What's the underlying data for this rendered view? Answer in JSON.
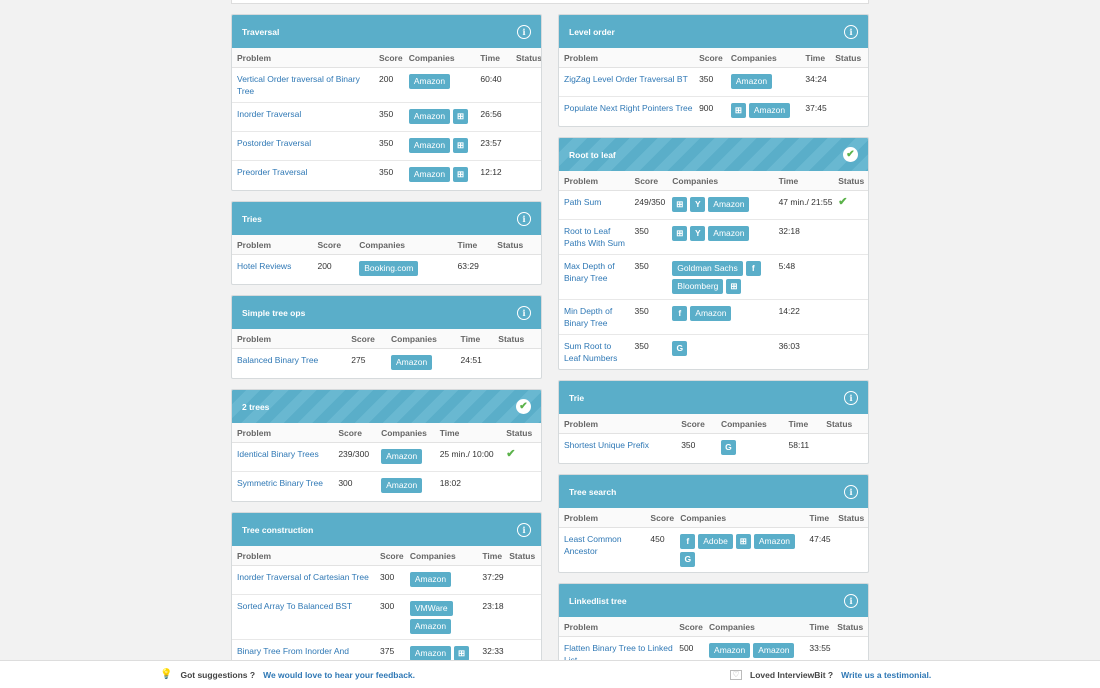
{
  "icons": {
    "info": "i",
    "check": "✔",
    "windows": "⊞",
    "facebook": "f",
    "google": "G",
    "yahoo": "Y"
  },
  "left": [
    {
      "title": "Traversal",
      "done": false,
      "cols": [
        "Problem",
        "Score",
        "Companies",
        "Time",
        "Status"
      ],
      "widths": [
        143,
        30,
        72,
        36,
        30
      ],
      "rows": [
        {
          "problem": "Vertical Order traversal of Binary Tree",
          "score": "200",
          "companies": [
            "Amazon"
          ],
          "time": "60:40",
          "status": ""
        },
        {
          "problem": "Inorder Traversal",
          "score": "350",
          "companies": [
            "Amazon",
            "windows"
          ],
          "time": "26:56",
          "status": ""
        },
        {
          "problem": "Postorder Traversal",
          "score": "350",
          "companies": [
            "Amazon",
            "windows"
          ],
          "time": "23:57",
          "status": ""
        },
        {
          "problem": "Preorder Traversal",
          "score": "350",
          "companies": [
            "Amazon",
            "windows"
          ],
          "time": "12:12",
          "status": ""
        }
      ]
    },
    {
      "title": "Tries",
      "done": false,
      "cols": [
        "Problem",
        "Score",
        "Companies",
        "Time",
        "Status"
      ],
      "widths": [
        81,
        42,
        99,
        40,
        49
      ],
      "rows": [
        {
          "problem": "Hotel Reviews",
          "score": "200",
          "companies": [
            "Booking.com"
          ],
          "time": "63:29",
          "status": ""
        }
      ]
    },
    {
      "title": "Simple tree ops",
      "done": false,
      "cols": [
        "Problem",
        "Score",
        "Companies",
        "Time",
        "Status"
      ],
      "widths": [
        115,
        40,
        70,
        38,
        48
      ],
      "rows": [
        {
          "problem": "Balanced Binary Tree",
          "score": "275",
          "companies": [
            "Amazon"
          ],
          "time": "24:51",
          "status": ""
        }
      ]
    },
    {
      "title": "2 trees",
      "done": true,
      "cols": [
        "Problem",
        "Score",
        "Companies",
        "Time",
        "Status"
      ],
      "widths": [
        102,
        43,
        59,
        67,
        40
      ],
      "rows": [
        {
          "problem": "Identical Binary Trees",
          "score": "239/300",
          "companies": [
            "Amazon"
          ],
          "time": "25 min./ 10:00",
          "status": "check"
        },
        {
          "problem": "Symmetric Binary Tree",
          "score": "300",
          "companies": [
            "Amazon"
          ],
          "time": "18:02",
          "status": ""
        }
      ]
    },
    {
      "title": "Tree construction",
      "done": false,
      "cols": [
        "Problem",
        "Score",
        "Companies",
        "Time",
        "Status"
      ],
      "widths": [
        144,
        30,
        73,
        27,
        37
      ],
      "rows": [
        {
          "problem": "Inorder Traversal of Cartesian Tree",
          "score": "300",
          "companies": [
            "Amazon"
          ],
          "time": "37:29",
          "status": ""
        },
        {
          "problem": "Sorted Array To Balanced BST",
          "score": "300",
          "companies": [
            "VMWare",
            "Amazon"
          ],
          "time": "23:18",
          "status": ""
        },
        {
          "problem": "Binary Tree From Inorder And Postorder",
          "score": "375",
          "companies": [
            "Amazon",
            "windows"
          ],
          "time": "32:33",
          "status": ""
        }
      ]
    }
  ],
  "right": [
    {
      "title": "Level order",
      "done": false,
      "cols": [
        "Problem",
        "Score",
        "Companies",
        "Time",
        "Status"
      ],
      "widths": [
        136,
        32,
        75,
        30,
        38
      ],
      "rows": [
        {
          "problem": "ZigZag Level Order Traversal BT",
          "score": "350",
          "companies": [
            "Amazon"
          ],
          "time": "34:24",
          "status": ""
        },
        {
          "problem": "Populate Next Right Pointers Tree",
          "score": "900",
          "companies": [
            "windows",
            "Amazon"
          ],
          "time": "37:45",
          "status": ""
        }
      ]
    },
    {
      "title": "Root to leaf",
      "done": true,
      "cols": [
        "Problem",
        "Score",
        "Companies",
        "Time",
        "Status"
      ],
      "widths": [
        71,
        38,
        107,
        60,
        35
      ],
      "rows": [
        {
          "problem": "Path Sum",
          "score": "249/350",
          "companies": [
            "windows",
            "yahoo",
            "Amazon"
          ],
          "time": "47 min./ 21:55",
          "status": "check"
        },
        {
          "problem": "Root to Leaf Paths With Sum",
          "score": "350",
          "companies": [
            "windows",
            "yahoo",
            "Amazon"
          ],
          "time": "32:18",
          "status": ""
        },
        {
          "problem": "Max Depth of Binary Tree",
          "score": "350",
          "companies": [
            "Goldman Sachs",
            "facebook",
            "Bloomberg",
            "windows"
          ],
          "time": "5:48",
          "status": ""
        },
        {
          "problem": "Min Depth of Binary Tree",
          "score": "350",
          "companies": [
            "facebook",
            "Amazon"
          ],
          "time": "14:22",
          "status": ""
        },
        {
          "problem": "Sum Root to Leaf Numbers",
          "score": "350",
          "companies": [
            "google"
          ],
          "time": "36:03",
          "status": ""
        }
      ]
    },
    {
      "title": "Trie",
      "done": false,
      "cols": [
        "Problem",
        "Score",
        "Companies",
        "Time",
        "Status"
      ],
      "widths": [
        118,
        40,
        68,
        38,
        47
      ],
      "rows": [
        {
          "problem": "Shortest Unique Prefix",
          "score": "350",
          "companies": [
            "google"
          ],
          "time": "58:11",
          "status": ""
        }
      ]
    },
    {
      "title": "Tree search",
      "done": false,
      "cols": [
        "Problem",
        "Score",
        "Companies",
        "Time",
        "Status"
      ],
      "widths": [
        87,
        30,
        130,
        29,
        35
      ],
      "rows": [
        {
          "problem": "Least Common Ancestor",
          "score": "450",
          "companies": [
            "facebook",
            "Adobe",
            "windows",
            "Amazon",
            "google"
          ],
          "time": "47:45",
          "status": ""
        }
      ]
    },
    {
      "title": "Linkedlist tree",
      "done": false,
      "cols": [
        "Problem",
        "Score",
        "Companies",
        "Time",
        "Status"
      ],
      "widths": [
        116,
        30,
        101,
        28,
        36
      ],
      "rows": [
        {
          "problem": "Flatten Binary Tree to Linked List",
          "score": "500",
          "companies": [
            "Amazon",
            "Amazon"
          ],
          "time": "33:55",
          "status": ""
        }
      ]
    }
  ],
  "footer": {
    "suggest_label": "Got suggestions ?",
    "suggest_link": "We would love to hear your feedback.",
    "loved_label": "Loved InterviewBit ?",
    "loved_link": "Write us a testimonial."
  }
}
